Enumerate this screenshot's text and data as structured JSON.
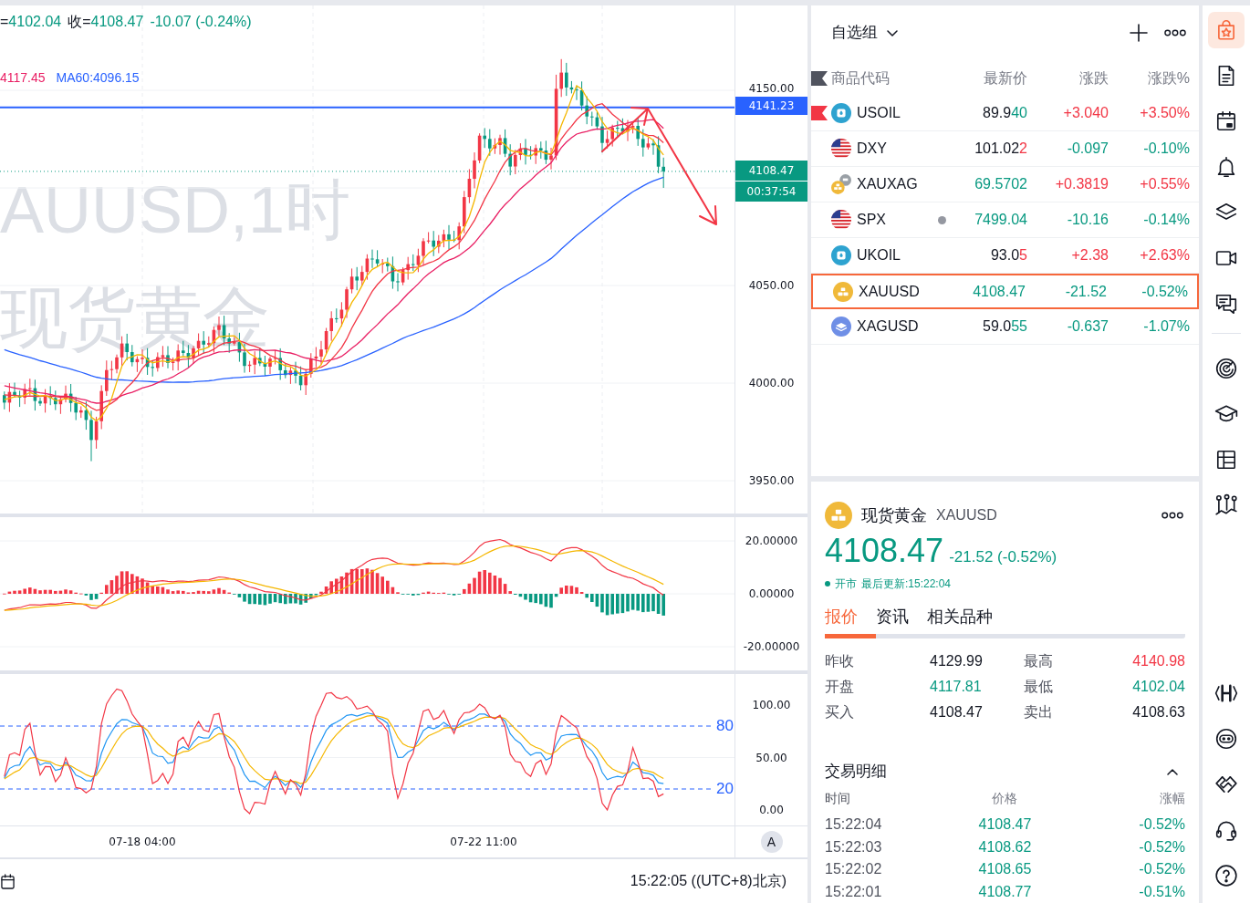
{
  "chart": {
    "ohlc_legend": {
      "rising": false,
      "items": [
        {
          "label": "=",
          "value": "4102.04"
        },
        {
          "label": "收=",
          "value": "4108.47"
        },
        {
          "value": "-10.07 (-0.24%)"
        }
      ]
    },
    "ma_legend": [
      {
        "text": "4117.45",
        "color": "#e91e63"
      },
      {
        "text": "MA60:4096.15",
        "color": "#2962ff"
      }
    ],
    "watermark": {
      "symbol": "AUUSD,1时",
      "name": "现货黄金"
    },
    "price_axis": [
      "4150.00",
      "4050.00",
      "4000.00",
      "3950.00"
    ],
    "line_label": "4141.23",
    "last_price": {
      "price": "4108.47",
      "countdown": "00:37:54"
    },
    "macd_axis": [
      "20.00000",
      "0.00000",
      "-20.00000"
    ],
    "stoch_axis": [
      "100.00",
      "50.00",
      "0.00"
    ],
    "stoch_levels": [
      "80",
      "20"
    ],
    "time_axis": [
      "07-18 04:00",
      "07-22 11:00"
    ],
    "scale_button": "A",
    "clock": "15:22:05 ((UTC+8)北京)"
  },
  "watchlist": {
    "title": "自选组",
    "columns": [
      "商品代码",
      "最新价",
      "涨跌",
      "涨跌%"
    ],
    "rows": [
      {
        "kind": "oil",
        "symbol": "USOIL",
        "flagged": true,
        "closed": false,
        "selected": false,
        "price_head": "89.9",
        "price_tail": "40",
        "tail_rising": false,
        "change": "+3.040",
        "change_pct": "+3.50%",
        "rising": true
      },
      {
        "kind": "index",
        "symbol": "DXY",
        "flagged": false,
        "closed": false,
        "selected": false,
        "price_head": "101.02",
        "price_tail": "2",
        "tail_rising": true,
        "change": "-0.097",
        "change_pct": "-0.10%",
        "rising": false
      },
      {
        "kind": "ratio",
        "symbol": "XAUXAG",
        "flagged": false,
        "closed": false,
        "selected": false,
        "price_tail": "69.5702",
        "tail_rising": false,
        "change": "+0.3819",
        "change_pct": "+0.55%",
        "rising": true
      },
      {
        "kind": "index",
        "symbol": "SPX",
        "flagged": false,
        "closed": true,
        "selected": false,
        "price_tail": "7499.04",
        "tail_rising": false,
        "change": "-10.16",
        "change_pct": "-0.14%",
        "rising": false
      },
      {
        "kind": "oil",
        "symbol": "UKOIL",
        "flagged": false,
        "closed": false,
        "selected": false,
        "price_head": "93.0",
        "price_tail": "5",
        "tail_rising": true,
        "change": "+2.38",
        "change_pct": "+2.63%",
        "rising": true
      },
      {
        "kind": "gold",
        "symbol": "XAUUSD",
        "flagged": false,
        "closed": false,
        "selected": true,
        "price_tail": "4108.47",
        "tail_rising": false,
        "change": "-21.52",
        "change_pct": "-0.52%",
        "rising": false
      },
      {
        "kind": "silver",
        "symbol": "XAGUSD",
        "flagged": false,
        "closed": false,
        "selected": false,
        "price_head": "59.0",
        "price_tail": "55",
        "tail_rising": false,
        "change": "-0.637",
        "change_pct": "-1.07%",
        "rising": false
      }
    ]
  },
  "detail": {
    "kind": "gold",
    "name": "现货黄金",
    "symbol": "XAUUSD",
    "price": "4108.47",
    "change": "-21.52 (-0.52%)",
    "rising": false,
    "market_open": true,
    "market_status": "开市",
    "updated": "最后更新:15:22:04",
    "tabs": [
      {
        "label": "报价",
        "selected": true
      },
      {
        "label": "资讯",
        "selected": false
      },
      {
        "label": "相关品种",
        "selected": false
      }
    ],
    "stats": [
      {
        "label": "昨收",
        "value": "4129.99",
        "color": "#131722"
      },
      {
        "label": "最高",
        "value": "4140.98",
        "color": "#f23645"
      },
      {
        "label": "开盘",
        "value": "4117.81",
        "color": "#089981"
      },
      {
        "label": "最低",
        "value": "4102.04",
        "color": "#089981"
      },
      {
        "label": "买入",
        "value": "4108.47",
        "color": "#131722"
      },
      {
        "label": "卖出",
        "value": "4108.63",
        "color": "#131722"
      }
    ],
    "trades": {
      "title": "交易明细",
      "expanded": true,
      "columns": [
        "时间",
        "价格",
        "涨幅"
      ],
      "rows": [
        {
          "time": "15:22:04",
          "price": "4108.47",
          "change_pct": "-0.52%",
          "rising": false
        },
        {
          "time": "15:22:03",
          "price": "4108.62",
          "change_pct": "-0.52%",
          "rising": false
        },
        {
          "time": "15:22:02",
          "price": "4108.65",
          "change_pct": "-0.52%",
          "rising": false
        },
        {
          "time": "15:22:01",
          "price": "4108.77",
          "change_pct": "-0.51%",
          "rising": false
        }
      ]
    }
  },
  "right_toolbar": {
    "primary": [
      {
        "kind": "watchlist",
        "selected": true
      },
      {
        "kind": "news",
        "selected": false
      },
      {
        "kind": "calendar",
        "selected": false
      },
      {
        "kind": "alerts",
        "selected": false
      },
      {
        "kind": "layers",
        "selected": false
      },
      {
        "kind": "video",
        "selected": false
      },
      {
        "kind": "chat",
        "selected": false
      }
    ],
    "tools": [
      {
        "kind": "target",
        "selected": false
      },
      {
        "kind": "education",
        "selected": false
      },
      {
        "kind": "table",
        "selected": false
      },
      {
        "kind": "strategy",
        "selected": false
      }
    ],
    "footer": [
      {
        "kind": "code",
        "selected": false
      },
      {
        "kind": "bot",
        "selected": false
      },
      {
        "kind": "partner",
        "selected": false
      },
      {
        "kind": "support",
        "selected": false
      },
      {
        "kind": "help",
        "selected": false
      }
    ]
  }
}
